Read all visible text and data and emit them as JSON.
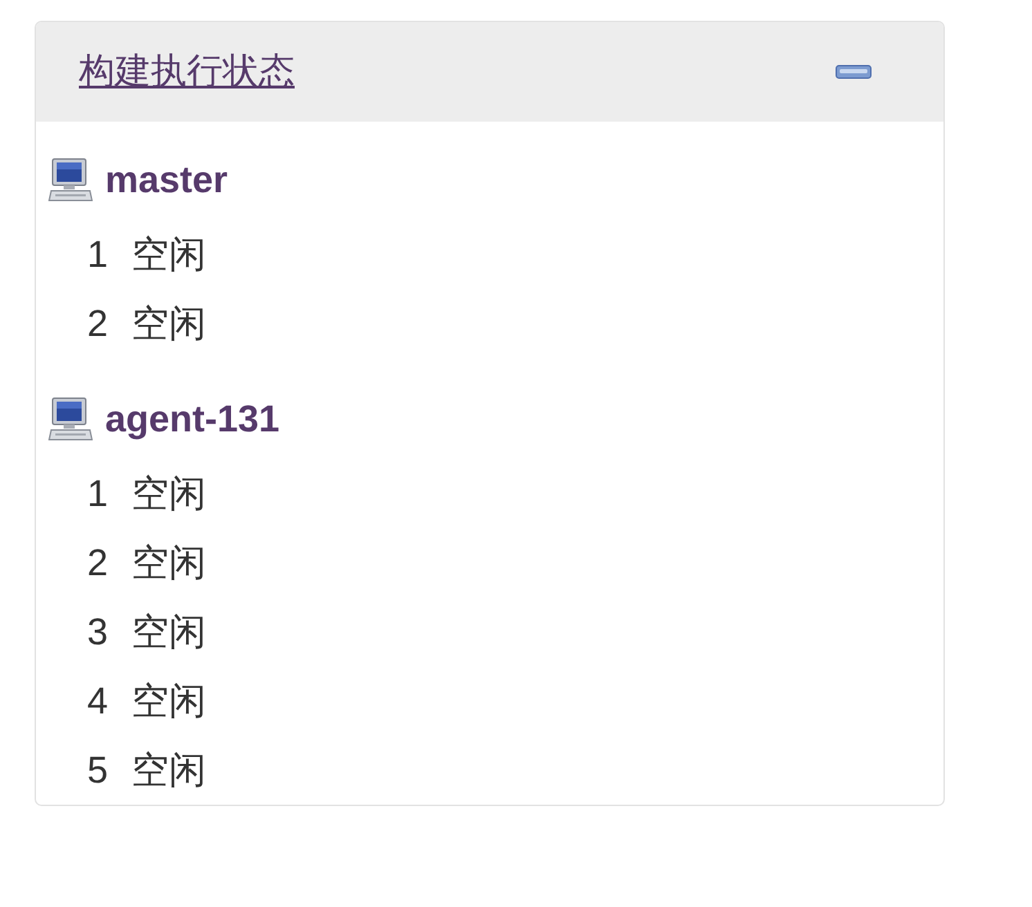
{
  "panel": {
    "title": "构建执行状态",
    "expanded": true
  },
  "nodes": [
    {
      "name": "master",
      "executors": [
        {
          "number": "1",
          "status": "空闲"
        },
        {
          "number": "2",
          "status": "空闲"
        }
      ]
    },
    {
      "name": "agent-131",
      "executors": [
        {
          "number": "1",
          "status": "空闲"
        },
        {
          "number": "2",
          "status": "空闲"
        },
        {
          "number": "3",
          "status": "空闲"
        },
        {
          "number": "4",
          "status": "空闲"
        },
        {
          "number": "5",
          "status": "空闲"
        }
      ]
    }
  ]
}
